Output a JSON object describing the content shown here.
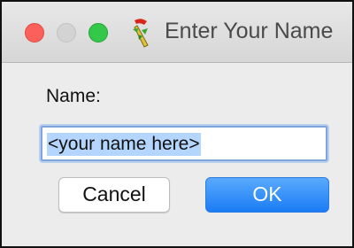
{
  "window": {
    "title": "Enter Your Name",
    "app_icon": "wand-icon"
  },
  "form": {
    "name_label": "Name:",
    "name_value": "<your name here>"
  },
  "buttons": {
    "cancel_label": "Cancel",
    "ok_label": "OK"
  },
  "colors": {
    "close_light": "#fc605b",
    "minimize_light": "#d3d3d3",
    "maximize_light": "#34c84a",
    "ok_button": "#1a7cf5",
    "selection": "#b4d5fe"
  }
}
